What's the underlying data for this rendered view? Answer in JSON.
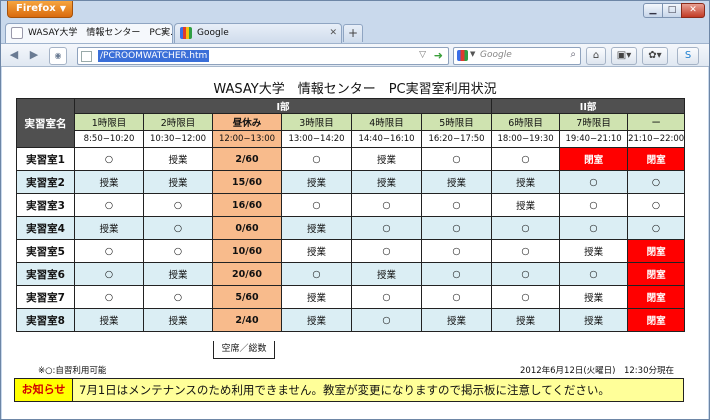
{
  "browser": {
    "menu_button": "Firefox",
    "tabs": [
      {
        "label": "WASAY大学　情報センター　PC実..."
      },
      {
        "label": "Google"
      }
    ],
    "new_tab": "+",
    "url": "/PCROOMWATCHER.htm",
    "search_placeholder": "Google"
  },
  "page": {
    "title": "WASAY大学　情報センター　PC実習室利用状況",
    "room_header": "実習室名",
    "section_1": "I部",
    "section_2": "II部",
    "periods": [
      {
        "name": "1時限目",
        "time": "8:50−10:20"
      },
      {
        "name": "2時限目",
        "time": "10:30−12:00"
      },
      {
        "name": "昼休み",
        "time": "12:00−13:00"
      },
      {
        "name": "3時限目",
        "time": "13:00−14:20"
      },
      {
        "name": "4時限目",
        "time": "14:40−16:10"
      },
      {
        "name": "5時限目",
        "time": "16:20−17:50"
      },
      {
        "name": "6時限目",
        "time": "18:00−19:30"
      },
      {
        "name": "7時限目",
        "time": "19:40−21:10"
      },
      {
        "name": "ー",
        "time": "21:10−22:00"
      }
    ],
    "rooms": [
      {
        "name": "実習室1",
        "cells": [
          "○",
          "授業",
          "2/60",
          "○",
          "授業",
          "○",
          "○",
          "閉室",
          "閉室"
        ]
      },
      {
        "name": "実習室2",
        "cells": [
          "授業",
          "授業",
          "15/60",
          "授業",
          "授業",
          "授業",
          "授業",
          "○",
          "○"
        ]
      },
      {
        "name": "実習室3",
        "cells": [
          "○",
          "○",
          "16/60",
          "○",
          "○",
          "○",
          "授業",
          "○",
          "○"
        ]
      },
      {
        "name": "実習室4",
        "cells": [
          "授業",
          "○",
          "0/60",
          "授業",
          "○",
          "○",
          "○",
          "○",
          "○"
        ]
      },
      {
        "name": "実習室5",
        "cells": [
          "○",
          "○",
          "10/60",
          "授業",
          "○",
          "○",
          "○",
          "授業",
          "閉室"
        ]
      },
      {
        "name": "実習室6",
        "cells": [
          "○",
          "授業",
          "20/60",
          "○",
          "授業",
          "○",
          "○",
          "○",
          "閉室"
        ]
      },
      {
        "name": "実習室7",
        "cells": [
          "○",
          "○",
          "5/60",
          "授業",
          "○",
          "○",
          "○",
          "授業",
          "閉室"
        ]
      },
      {
        "name": "実習室8",
        "cells": [
          "授業",
          "授業",
          "2/40",
          "授業",
          "○",
          "授業",
          "授業",
          "授業",
          "閉室"
        ]
      }
    ],
    "legend": "空席／総数",
    "note": "※○:自習利用可能",
    "timestamp": "2012年6月12日(火曜日)　12:30分現在",
    "notice_label": "お知らせ",
    "notice_text": "7月1日はメンテナンスのため利用できません。教室が変更になりますので掲示板に注意してください。"
  }
}
